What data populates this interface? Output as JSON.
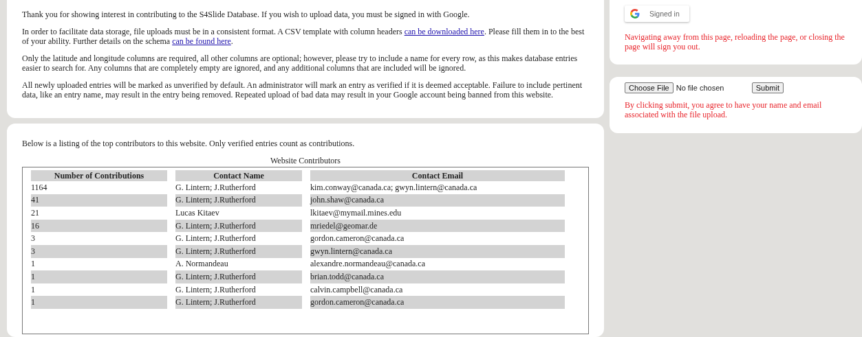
{
  "intro": {
    "paragraphs": [
      [
        {
          "kind": "text",
          "text": "Thank you for showing interest in contributing to the S4Slide Database. If you wish to upload data, you must be signed in with Google."
        }
      ],
      [
        {
          "kind": "text",
          "text": "In order to facilitate data storage, file uploads must be in a consistent format. A CSV template with column headers "
        },
        {
          "kind": "link",
          "text": "can be downloaded here"
        },
        {
          "kind": "text",
          "text": ". Please fill them in to the best of your ability. Further details on the schema "
        },
        {
          "kind": "link",
          "text": "can be found here"
        },
        {
          "kind": "text",
          "text": "."
        }
      ],
      [
        {
          "kind": "text",
          "text": "Only the latitude and longitude columns are required, all other columns are optional; however, please try to include a name for every row, as this makes database entries easier to search for. Any columns that are completely empty are ignored, and any additional columns that are included will be ignored."
        }
      ],
      [
        {
          "kind": "text",
          "text": "All newly uploaded entries will be marked as unverified by default. An administrator will mark an entry as verified if it is deemed acceptable. Failure to include pertinent data, like an entry name, may result in the entry being removed. Repeated upload of bad data may result in your Google account being banned from this website."
        }
      ]
    ]
  },
  "contributors": {
    "description": "Below is a listing of the top contributors to this website. Only verified entries count as contributions.",
    "table": {
      "caption": "Website Contributors",
      "columns": [
        "Number of Contributions",
        "Contact Name",
        "Contact Email"
      ],
      "rows": [
        [
          "1164",
          "G. Lintern; J.Rutherford",
          "kim.conway@canada.ca; gwyn.lintern@canada.ca"
        ],
        [
          "41",
          "G. Lintern; J.Rutherford",
          "john.shaw@canada.ca"
        ],
        [
          "21",
          "Lucas Kitaev",
          "lkitaev@mymail.mines.edu"
        ],
        [
          "16",
          "G. Lintern; J.Rutherford",
          "mriedel@geomar.de"
        ],
        [
          "3",
          "G. Lintern; J.Rutherford",
          "gordon.cameron@canada.ca"
        ],
        [
          "3",
          "G. Lintern; J.Rutherford",
          "gwyn.lintern@canada.ca"
        ],
        [
          "1",
          "A. Normandeau",
          "alexandre.normandeau@canada.ca"
        ],
        [
          "1",
          "G. Lintern; J.Rutherford",
          "brian.todd@canada.ca"
        ],
        [
          "1",
          "G. Lintern; J.Rutherford",
          "calvin.campbell@canada.ca"
        ],
        [
          "1",
          "G. Lintern; J.Rutherford",
          "gordon.cameron@canada.ca"
        ]
      ]
    }
  },
  "sign_in": {
    "button": "Signed in",
    "warning": "Navigating away from this page, reloading the page, or closing the page will sign you out."
  },
  "upload": {
    "choose_button": "Choose File",
    "file_status": "No file chosen",
    "submit_button": "Submit",
    "notice": "By clicking submit, you agree to have your name and email associated with the file upload."
  }
}
